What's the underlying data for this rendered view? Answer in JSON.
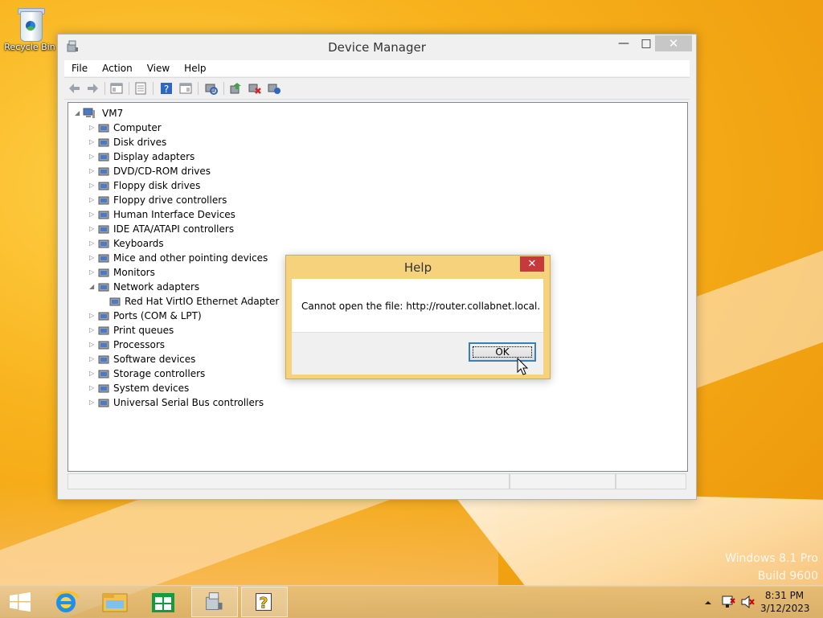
{
  "desktop": {
    "recycle_bin_label": "Recycle Bin",
    "watermark_line1": "Windows 8.1 Pro",
    "watermark_line2": "Build 9600"
  },
  "device_manager": {
    "title": "Device Manager",
    "window_buttons": {
      "minimize": "—",
      "maximize": "□",
      "close": "✕"
    },
    "menu": [
      "File",
      "Action",
      "View",
      "Help"
    ],
    "tree": {
      "root": "VM7",
      "items": [
        {
          "label": "Computer",
          "expanded": false,
          "icon": "computer-icon"
        },
        {
          "label": "Disk drives",
          "expanded": false,
          "icon": "disk-drive-icon"
        },
        {
          "label": "Display adapters",
          "expanded": false,
          "icon": "display-adapter-icon"
        },
        {
          "label": "DVD/CD-ROM drives",
          "expanded": false,
          "icon": "dvd-drive-icon"
        },
        {
          "label": "Floppy disk drives",
          "expanded": false,
          "icon": "floppy-drive-icon"
        },
        {
          "label": "Floppy drive controllers",
          "expanded": false,
          "icon": "floppy-controller-icon"
        },
        {
          "label": "Human Interface Devices",
          "expanded": false,
          "icon": "hid-icon"
        },
        {
          "label": "IDE ATA/ATAPI controllers",
          "expanded": false,
          "icon": "ide-controller-icon"
        },
        {
          "label": "Keyboards",
          "expanded": false,
          "icon": "keyboard-icon"
        },
        {
          "label": "Mice and other pointing devices",
          "expanded": false,
          "icon": "mouse-icon"
        },
        {
          "label": "Monitors",
          "expanded": false,
          "icon": "monitor-icon"
        },
        {
          "label": "Network adapters",
          "expanded": true,
          "icon": "network-adapter-icon"
        },
        {
          "label": "Red Hat VirtIO Ethernet Adapter",
          "child": true,
          "icon": "network-adapter-icon"
        },
        {
          "label": "Ports (COM & LPT)",
          "expanded": false,
          "icon": "port-icon"
        },
        {
          "label": "Print queues",
          "expanded": false,
          "icon": "printer-icon"
        },
        {
          "label": "Processors",
          "expanded": false,
          "icon": "processor-icon"
        },
        {
          "label": "Software devices",
          "expanded": false,
          "icon": "software-device-icon"
        },
        {
          "label": "Storage controllers",
          "expanded": false,
          "icon": "storage-controller-icon"
        },
        {
          "label": "System devices",
          "expanded": false,
          "icon": "system-device-icon"
        },
        {
          "label": "Universal Serial Bus controllers",
          "expanded": false,
          "icon": "usb-icon"
        }
      ]
    }
  },
  "help_dialog": {
    "title": "Help",
    "close": "✕",
    "message": "Cannot open the file: http://router.collabnet.local.",
    "ok_label": "OK"
  },
  "taskbar": {
    "clock_time": "8:31 PM",
    "clock_date": "3/12/2023",
    "items": [
      "start-icon",
      "internet-explorer-icon",
      "file-explorer-icon",
      "store-icon",
      "device-manager-icon",
      "help-icon"
    ]
  },
  "colors": {
    "accent_red": "#c7393a",
    "dialog_frame": "#f6d27c",
    "wallpaper": "#f0a010"
  }
}
